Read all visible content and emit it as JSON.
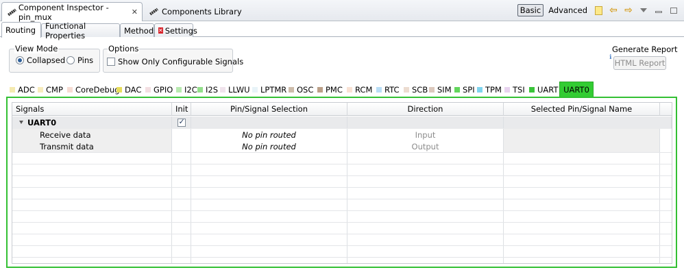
{
  "view_tabs": {
    "inspector_title": "Component Inspector - pin_mux",
    "library_title": "Components Library"
  },
  "toolbar": {
    "basic_label": "Basic",
    "advanced_label": "Advanced",
    "selected_mode": "Basic"
  },
  "inner_tabs": [
    "Routing",
    "Functional Properties",
    "Methods",
    "Settings"
  ],
  "inner_tab_active": "Routing",
  "view_mode": {
    "title": "View Mode",
    "collapsed_label": "Collapsed",
    "pins_label": "Pins",
    "selected": "Collapsed"
  },
  "options": {
    "title": "Options",
    "show_configurable_label": "Show Only Configurable Signals",
    "show_configurable_checked": false
  },
  "report": {
    "title": "Generate Report",
    "button_label": "HTML Report"
  },
  "peripheral_tabs": [
    {
      "label": "ADC",
      "color": "#f4eab0"
    },
    {
      "label": "CMP",
      "color": "#f7ecbd"
    },
    {
      "label": "CoreDebug",
      "color": "#f6dcd3"
    },
    {
      "label": "DAC",
      "color": "#e7dd5c"
    },
    {
      "label": "GPIO",
      "color": "#f3dfe2"
    },
    {
      "label": "I2C",
      "color": "#b8eab0"
    },
    {
      "label": "I2S",
      "color": "#93df8b"
    },
    {
      "label": "LLWU",
      "color": "#f0e3ec"
    },
    {
      "label": "LPTMR",
      "color": "#e8f3f8"
    },
    {
      "label": "OSC",
      "color": "#cdbcaa"
    },
    {
      "label": "PMC",
      "color": "#bca088"
    },
    {
      "label": "RCM",
      "color": "#f9e2d4"
    },
    {
      "label": "RTC",
      "color": "#b9def6"
    },
    {
      "label": "SCB",
      "color": "#ecdcd0"
    },
    {
      "label": "SIM",
      "color": "#dcc9bd"
    },
    {
      "label": "SPI",
      "color": "#63d65d"
    },
    {
      "label": "TPM",
      "color": "#7fd4ee"
    },
    {
      "label": "TSI",
      "color": "#e8d3ef"
    },
    {
      "label": "UART",
      "color": "#3ac43a"
    },
    {
      "label": "UART0",
      "color": "#33cc33"
    }
  ],
  "peripheral_active": "UART0",
  "table": {
    "columns": [
      "Signals",
      "Init",
      "Pin/Signal Selection",
      "Direction",
      "Selected Pin/Signal Name"
    ],
    "group": {
      "name": "UART0",
      "init_checked": true
    },
    "rows": [
      {
        "signal": "Receive data",
        "pin": "No pin routed",
        "direction": "Input",
        "name": ""
      },
      {
        "signal": "Transmit data",
        "pin": "No pin routed",
        "direction": "Output",
        "name": ""
      }
    ]
  }
}
